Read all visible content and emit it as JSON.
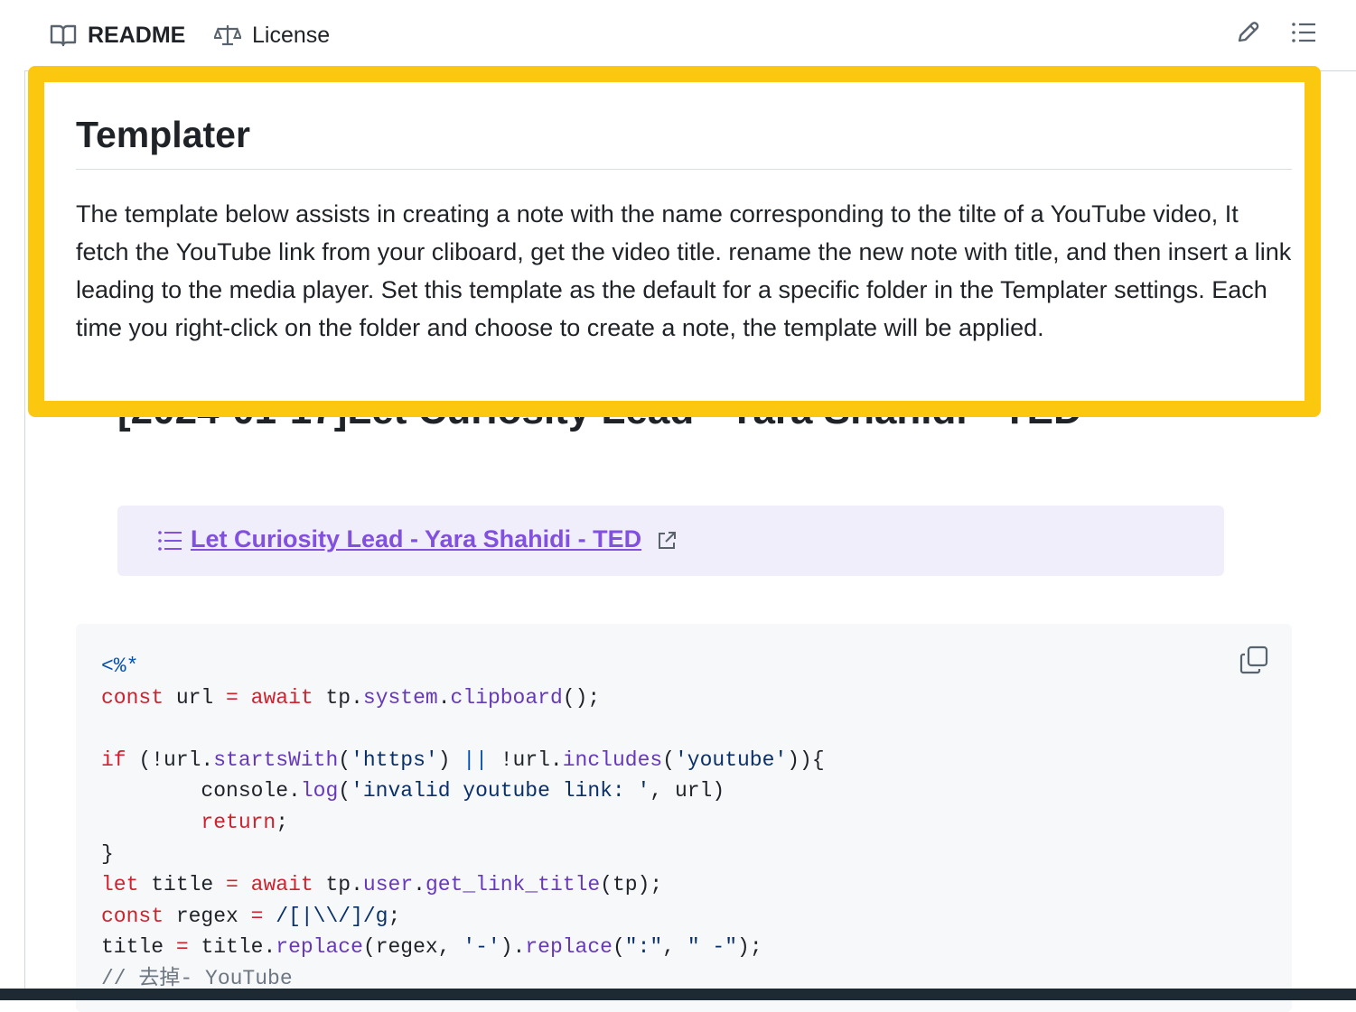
{
  "tabs": {
    "readme_label": "README",
    "license_label": "License"
  },
  "highlight": {
    "title": "Templater",
    "text": "The template below assists in creating a note with the name corresponding to the tilte of a YouTube video, It fetch the YouTube link from your cliboard, get the video title. rename the new note with title, and then insert a link leading to the media player. Set this template as the default for a specific folder in the Templater settings. Each time you right-click on the folder and choose to create a note, the template will be applied."
  },
  "doc": {
    "title": "[2024-01-17]Let Curiosity Lead - Yara Shahidi - TED",
    "callout_link": "Let Curiosity Lead - Yara Shahidi - TED"
  },
  "code": {
    "lines": [
      [
        {
          "t": "<%*",
          "c": "op"
        }
      ],
      [
        {
          "t": "const",
          "c": "kw"
        },
        {
          "t": " url "
        },
        {
          "t": "=",
          "c": "kw"
        },
        {
          "t": " "
        },
        {
          "t": "await",
          "c": "kw"
        },
        {
          "t": " tp."
        },
        {
          "t": "system",
          "c": "fn"
        },
        {
          "t": "."
        },
        {
          "t": "clipboard",
          "c": "fn"
        },
        {
          "t": "();"
        }
      ],
      [
        {
          "t": ""
        }
      ],
      [
        {
          "t": "if",
          "c": "kw"
        },
        {
          "t": " (!url."
        },
        {
          "t": "startsWith",
          "c": "fn"
        },
        {
          "t": "("
        },
        {
          "t": "'https'",
          "c": "str"
        },
        {
          "t": ") "
        },
        {
          "t": "||",
          "c": "op"
        },
        {
          "t": " !url."
        },
        {
          "t": "includes",
          "c": "fn"
        },
        {
          "t": "("
        },
        {
          "t": "'youtube'",
          "c": "str"
        },
        {
          "t": ")){"
        }
      ],
      [
        {
          "t": "        console."
        },
        {
          "t": "log",
          "c": "fn"
        },
        {
          "t": "("
        },
        {
          "t": "'invalid youtube link: '",
          "c": "str"
        },
        {
          "t": ", url)"
        }
      ],
      [
        {
          "t": "        "
        },
        {
          "t": "return",
          "c": "kw"
        },
        {
          "t": ";"
        }
      ],
      [
        {
          "t": "}"
        }
      ],
      [
        {
          "t": "let",
          "c": "kw"
        },
        {
          "t": " title "
        },
        {
          "t": "=",
          "c": "kw"
        },
        {
          "t": " "
        },
        {
          "t": "await",
          "c": "kw"
        },
        {
          "t": " tp."
        },
        {
          "t": "user",
          "c": "fn"
        },
        {
          "t": "."
        },
        {
          "t": "get_link_title",
          "c": "fn"
        },
        {
          "t": "(tp);"
        }
      ],
      [
        {
          "t": "const",
          "c": "kw"
        },
        {
          "t": " regex "
        },
        {
          "t": "=",
          "c": "kw"
        },
        {
          "t": " "
        },
        {
          "t": "/[|\\\\/]/g",
          "c": "str"
        },
        {
          "t": ";"
        }
      ],
      [
        {
          "t": "title "
        },
        {
          "t": "=",
          "c": "kw"
        },
        {
          "t": " title."
        },
        {
          "t": "replace",
          "c": "fn"
        },
        {
          "t": "(regex, "
        },
        {
          "t": "'-'",
          "c": "str"
        },
        {
          "t": ")."
        },
        {
          "t": "replace",
          "c": "fn"
        },
        {
          "t": "("
        },
        {
          "t": "\":\"",
          "c": "str"
        },
        {
          "t": ", "
        },
        {
          "t": "\" -\"",
          "c": "str"
        },
        {
          "t": ");"
        }
      ],
      [
        {
          "t": "// 去掉- YouTube",
          "c": "cm"
        }
      ]
    ]
  },
  "icons": {
    "readme": "book-icon",
    "license": "law-icon",
    "edit": "pencil-icon",
    "outline": "list-icon",
    "callout": "list-icon",
    "external": "external-link-icon",
    "copy": "copy-icon"
  },
  "colors": {
    "highlight_border": "#fcc80f",
    "callout_bg": "#f1eefc",
    "link": "#8250df",
    "code_bg": "#f6f8fa"
  }
}
